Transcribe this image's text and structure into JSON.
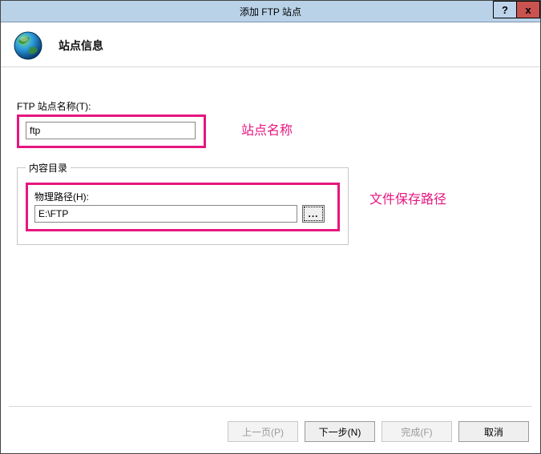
{
  "titlebar": {
    "title": "添加 FTP 站点",
    "help": "?",
    "close": "x"
  },
  "header": {
    "heading": "站点信息"
  },
  "form": {
    "site_name_label": "FTP 站点名称(T):",
    "site_name_value": "ftp",
    "content_dir_legend": "内容目录",
    "physical_path_label": "物理路径(H):",
    "physical_path_value": "E:\\FTP",
    "browse_label": "..."
  },
  "annotations": {
    "site_name": "站点名称",
    "file_path": "文件保存路径"
  },
  "buttons": {
    "previous": "上一页(P)",
    "next": "下一步(N)",
    "finish": "完成(F)",
    "cancel": "取消"
  }
}
